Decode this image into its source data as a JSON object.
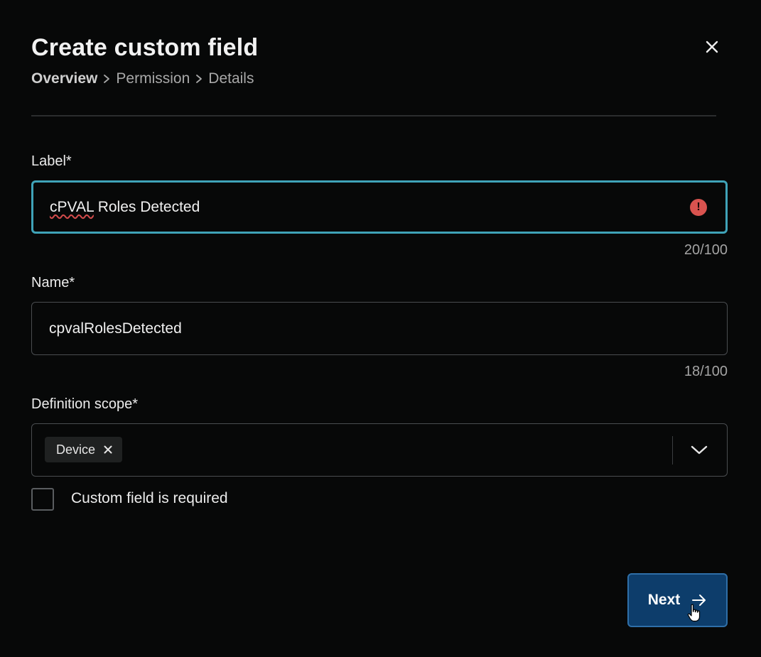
{
  "dialog": {
    "title": "Create custom field",
    "close_icon": "close-icon"
  },
  "breadcrumb": {
    "steps": [
      "Overview",
      "Permission",
      "Details"
    ],
    "active_step": "Overview",
    "separator_icon": "chevron-right-icon"
  },
  "label_field": {
    "label": "Label*",
    "value_misspelled_part": "cPVAL",
    "value_rest": " Roles Detected",
    "counter": "20/100",
    "status_icon": "error-icon",
    "status_glyph": "!"
  },
  "name_field": {
    "label": "Name*",
    "value": "cpvalRolesDetected",
    "counter": "18/100"
  },
  "scope_field": {
    "label": "Definition scope*",
    "selected_chips": [
      "Device"
    ],
    "chip_remove_icon": "close-icon",
    "dropdown_icon": "chevron-down-icon"
  },
  "required_checkbox": {
    "label": "Custom field is required",
    "checked": false
  },
  "footer": {
    "next_label": "Next",
    "next_icon": "arrow-right-icon"
  },
  "colors": {
    "background": "#070808",
    "focus_border": "#3fa3b8",
    "error": "#d9534f",
    "primary_button": "#0d3d6b",
    "primary_button_border": "#2f6fa8"
  }
}
